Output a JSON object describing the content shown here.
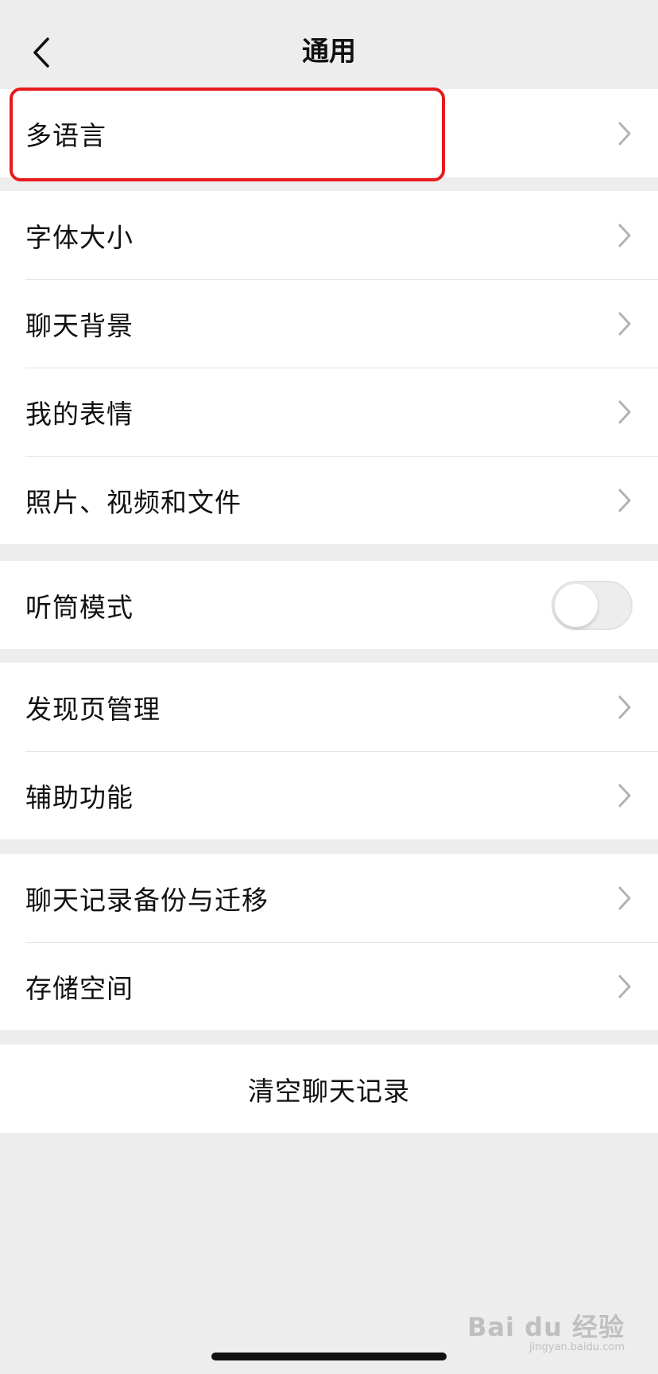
{
  "navbar": {
    "title": "通用",
    "back_icon": "chevron-left-icon"
  },
  "groups": {
    "language": {
      "items": [
        {
          "label": "多语言"
        }
      ]
    },
    "display": {
      "items": [
        {
          "label": "字体大小"
        },
        {
          "label": "聊天背景"
        },
        {
          "label": "我的表情"
        },
        {
          "label": "照片、视频和文件"
        }
      ]
    },
    "earpiece": {
      "label": "听筒模式",
      "enabled": false
    },
    "discover": {
      "items": [
        {
          "label": "发现页管理"
        },
        {
          "label": "辅助功能"
        }
      ]
    },
    "storage": {
      "items": [
        {
          "label": "聊天记录备份与迁移"
        },
        {
          "label": "存储空间"
        }
      ]
    },
    "clear": {
      "label": "清空聊天记录"
    }
  },
  "watermark": {
    "main": "Bai du 经验",
    "sub": "jingyan.baidu.com"
  },
  "colors": {
    "background": "#EDEDED",
    "cell": "#FFFFFF",
    "highlight": "#E8191A",
    "text": "#111111",
    "chevron": "#B2B2B2"
  }
}
